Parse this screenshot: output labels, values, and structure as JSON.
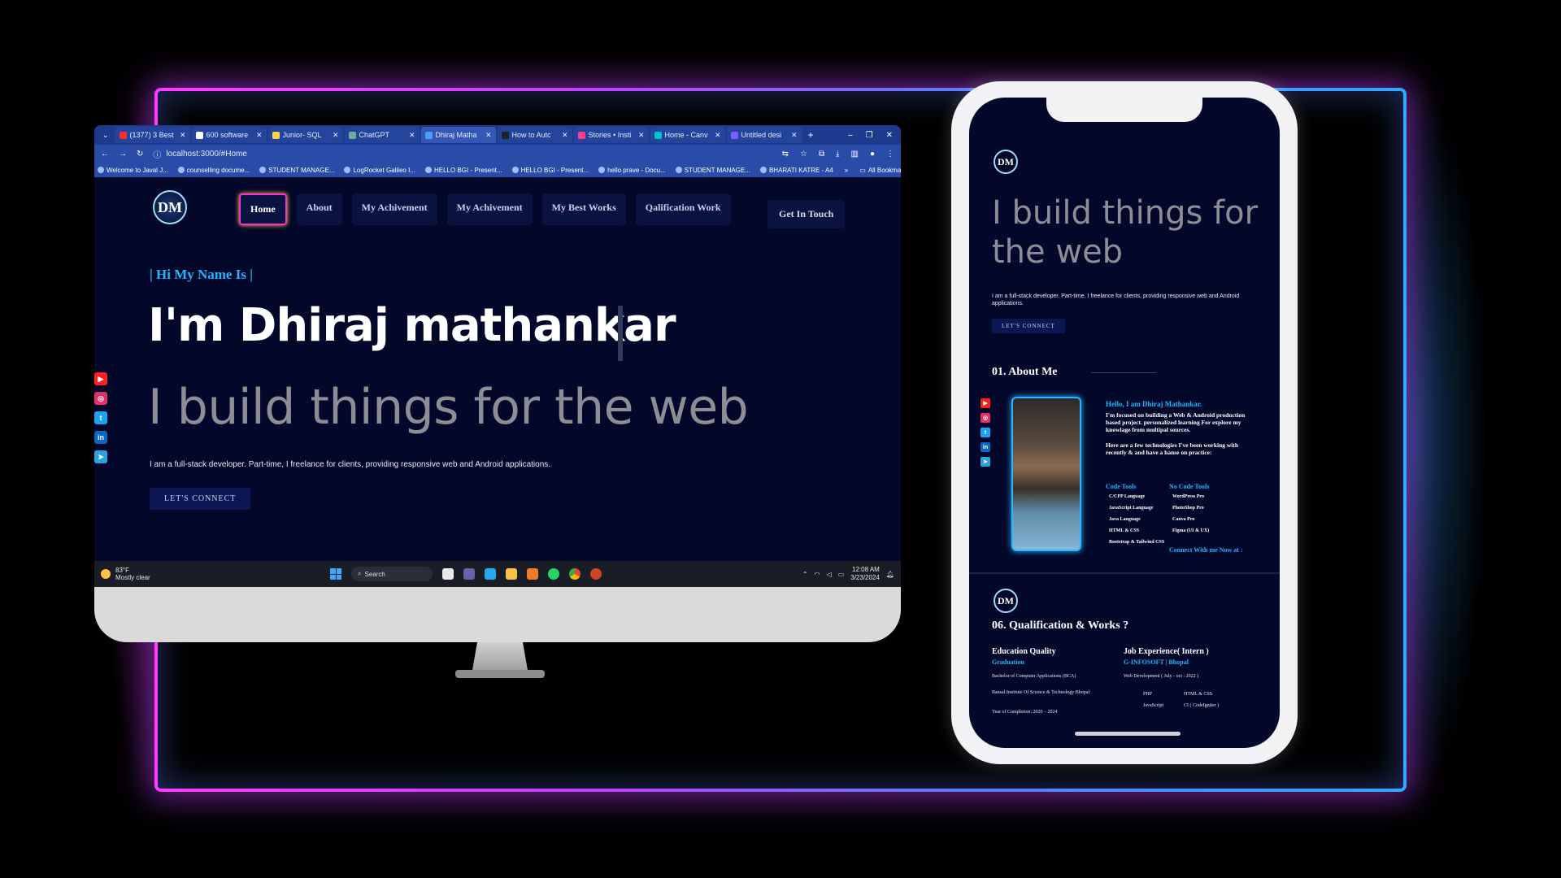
{
  "browser": {
    "tabs": [
      {
        "label": "(1377) 3 Best",
        "color": "#ff2a2a",
        "active": false
      },
      {
        "label": "600 software",
        "color": "#ffffff",
        "active": false
      },
      {
        "label": "Junior- SQL",
        "color": "#ffd24a",
        "active": false
      },
      {
        "label": "ChatGPT",
        "color": "#74aa9c",
        "active": false
      },
      {
        "label": "Dhiraj Matha",
        "color": "#4a9dff",
        "active": true
      },
      {
        "label": "How to Autc",
        "color": "#222222",
        "active": false
      },
      {
        "label": "Stories • Insti",
        "color": "#ff3d8a",
        "active": false
      },
      {
        "label": "Home - Canv",
        "color": "#00c4cc",
        "active": false
      },
      {
        "label": "Untitled desi",
        "color": "#7c5cff",
        "active": false
      }
    ],
    "url": "localhost:3000/#Home",
    "bookmarks": [
      "Welcome to Javal J...",
      "counselling docume...",
      "STUDENT MANAGE...",
      "LogRocket Galileo I...",
      "HELLO BGI - Present...",
      "HELLO BGI - Present...",
      "hello prave - Docu...",
      "STUDENT MANAGE...",
      "BHARATI KATRE - A4"
    ],
    "more_bookmarks": "All Bookmarks"
  },
  "site": {
    "logo": "DM",
    "nav": [
      "Home",
      "About",
      "My Achivement",
      "My Achivement",
      "My Best Works",
      "Qalification Work"
    ],
    "get_in_touch": "Get In Touch",
    "hi": "| Hi My Name Is |",
    "name": "I'm Dhiraj mathankar",
    "tagline": "I build things for the web",
    "intro": "I am a full-stack developer. Part-time, I freelance for clients, providing responsive web and Android applications.",
    "connect": "LET'S CONNECT",
    "socials": [
      {
        "name": "youtube",
        "glyph": "▶",
        "color": "#ff1f1f"
      },
      {
        "name": "instagram",
        "glyph": "◎",
        "color": "#e1306c"
      },
      {
        "name": "twitter",
        "glyph": "t",
        "color": "#1da1f2"
      },
      {
        "name": "linkedin",
        "glyph": "in",
        "color": "#0a66c2"
      },
      {
        "name": "telegram",
        "glyph": "➤",
        "color": "#2aa3de"
      }
    ]
  },
  "taskbar": {
    "temp": "83°F",
    "weather": "Mostly clear",
    "search": "Search",
    "time": "12:08 AM",
    "date": "3/23/2024"
  },
  "phone": {
    "title": "I build things for the web",
    "intro": "I am a full-stack developer. Part-time, I freelance for clients, providing responsive web and Android applications.",
    "connect": "LET'S CONNECT",
    "about_title": "01.   About Me",
    "hello": "Hello, I am Dhiraj Mathankar.",
    "bio": "I'm focused on building a Web & Android production based project. personalized learning For explore my knowlage from multipal sources.",
    "bio2": "Here are a few technologies I've been working with recently & and have a hanse on practice:",
    "code_tools_label": "Code Tools",
    "no_code_tools_label": "No Code Tools",
    "code_tools": [
      "C/CPP Language",
      "JavaScript Language",
      "Java Language",
      "HTML & CSS",
      "Bootstrap & Tailwind CSS"
    ],
    "no_code_tools": [
      "WordPress Pro",
      "PhotoShop Pro",
      "Canva Pro",
      "Figma (UI & UX)"
    ],
    "connect_me": "Connect With me Now at :",
    "qual_title": "06.   Qualification & Works ?",
    "edu_head": "Education Quality",
    "edu_sub": "Graduation",
    "edu_degree": "Bachelor of Computer Applications (BCA)",
    "edu_college": "Bansal Institute Of Science & Technology Bhopal",
    "edu_year": "Year of Completion: 2020 – 2024",
    "job_head": "Job Experience( Intern )",
    "job_sub": "G-INFOSOFT | Bhopal",
    "job_role": "Web Development ( July - oct : 2022 )",
    "job_skills": [
      "PHP",
      "HTML & CSS",
      "JavaScript",
      "CI ( CodeIgniter )"
    ]
  }
}
